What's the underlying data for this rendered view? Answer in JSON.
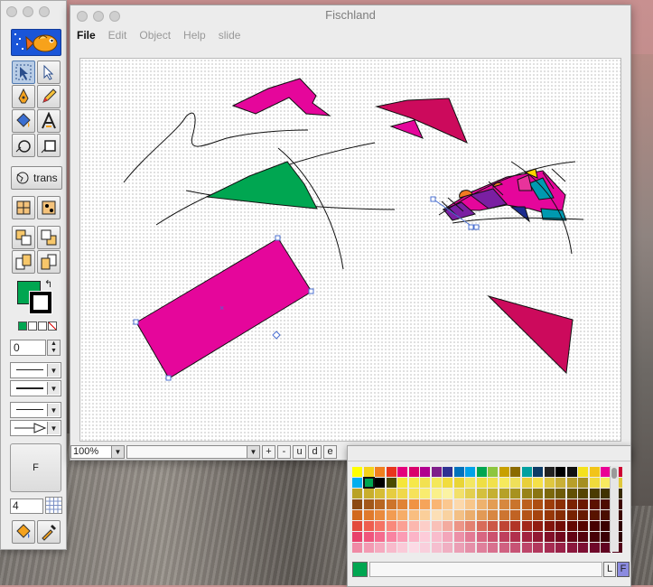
{
  "window": {
    "title": "Fischland",
    "menu": [
      {
        "label": "File",
        "enabled": true
      },
      {
        "label": "Edit",
        "enabled": false
      },
      {
        "label": "Object",
        "enabled": false
      },
      {
        "label": "Help",
        "enabled": false
      },
      {
        "label": "slide",
        "enabled": false
      }
    ]
  },
  "tools": {
    "transform_label": "trans",
    "line_width_value": "0",
    "fill_label": "F",
    "grid_value": "4",
    "fill_color": "#00a651",
    "stroke_color": "#000000"
  },
  "status": {
    "zoom": "100%",
    "buttons": [
      "+",
      "-",
      "u",
      "d",
      "e"
    ]
  },
  "palette": {
    "current_color": "#00a651",
    "buttons": [
      "L",
      "F"
    ],
    "selected_index": 25,
    "colors": [
      "#ffff00",
      "#f5d21a",
      "#f07f1f",
      "#e8351c",
      "#e4007c",
      "#d9006c",
      "#b1008f",
      "#7f1e8a",
      "#2e3192",
      "#0072bc",
      "#00a2e8",
      "#00a651",
      "#8dc63f",
      "#c8a000",
      "#8b6b00",
      "#00a0a0",
      "#0d3b66",
      "#222222",
      "#000000",
      "#111111",
      "#f4e21d",
      "#f2c418",
      "#ea0096",
      "#cc0033",
      "#00aeef",
      "#00a651",
      "#000000",
      "#4a4a00",
      "#f5e63a",
      "#f6e84a",
      "#f2e150",
      "#f4e85a",
      "#f1dc3e",
      "#e9d536",
      "#f3e762",
      "#efdf44",
      "#f1e14c",
      "#f6ea5c",
      "#efe05a",
      "#e8cf3a",
      "#f5e048",
      "#dfc740",
      "#c9b037",
      "#b89f2a",
      "#a58f22",
      "#f0db3c",
      "#f7ea60",
      "#e0c83c",
      "#b9a225",
      "#c8ae2c",
      "#d6bd35",
      "#e6cd40",
      "#f0d84a",
      "#f6e25a",
      "#f9ec6f",
      "#faf08a",
      "#fbf3a3",
      "#f2e06a",
      "#e3cf4e",
      "#d4c03d",
      "#c5b032",
      "#b6a128",
      "#a7921f",
      "#988318",
      "#8a7512",
      "#7c680c",
      "#6f5b08",
      "#625004",
      "#564502",
      "#4b3b01",
      "#403200",
      "#362a00",
      "#8b4a12",
      "#a2581a",
      "#b86622",
      "#cd742b",
      "#e08336",
      "#f09344",
      "#f6a45a",
      "#f9b574",
      "#fbc78f",
      "#fcd8ab",
      "#f8c68a",
      "#eeb26e",
      "#e39d55",
      "#d7883f",
      "#ca742c",
      "#bc601d",
      "#ad4e12",
      "#9d3d0a",
      "#8c2f05",
      "#7b2302",
      "#6b1901",
      "#5b1100",
      "#4c0b00",
      "#3e0700",
      "#d2691e",
      "#e07a2c",
      "#ea8b3e",
      "#f29c52",
      "#f6ad68",
      "#f9be80",
      "#fbcf9a",
      "#fcdfb6",
      "#f9d2a0",
      "#f3c085",
      "#ebad6c",
      "#e29a56",
      "#d88742",
      "#cd7531",
      "#c16323",
      "#b45318",
      "#a6440f",
      "#973708",
      "#872c04",
      "#772202",
      "#671a01",
      "#581300",
      "#4a0d00",
      "#3d0800",
      "#e34b3c",
      "#ee5e4f",
      "#f57364",
      "#f9897b",
      "#fba094",
      "#fcb7ae",
      "#fdcec8",
      "#f9c0b8",
      "#f3ab9f",
      "#ec9587",
      "#e38070",
      "#d86b5a",
      "#cc5746",
      "#bf4535",
      "#b13527",
      "#a2281b",
      "#921d12",
      "#82140b",
      "#720d06",
      "#630803",
      "#550401",
      "#470201",
      "#3a0100",
      "#2e0000",
      "#e8416b",
      "#f0557c",
      "#f56b8e",
      "#f983a1",
      "#fb9bb4",
      "#fcb4c7",
      "#fdccd9",
      "#f9bccc",
      "#f3a6ba",
      "#ec90a7",
      "#e37a94",
      "#d86681",
      "#cc526e",
      "#bf405d",
      "#b1304d",
      "#a2233f",
      "#921832",
      "#820f27",
      "#72081d",
      "#630414",
      "#55020d",
      "#470107",
      "#3a0004",
      "#2e0002",
      "#f08aa5",
      "#f39ab2",
      "#f6aabf",
      "#f8bacb",
      "#facad8",
      "#fcdae5",
      "#f9cfdc",
      "#f5bfcf",
      "#f0afc2",
      "#eb9fb5",
      "#e58fa8",
      "#df7f9b",
      "#d8708e",
      "#d06181",
      "#c75375",
      "#bd4569",
      "#b2385d",
      "#a62c52",
      "#992147",
      "#8b173d",
      "#7d0f33",
      "#6f092a",
      "#610421",
      "#530119"
    ]
  },
  "canvas": {
    "shape_colors": {
      "magenta": "#e5069b",
      "crimson": "#cc0a5c",
      "green": "#00a651",
      "purple": "#7a1fa2",
      "teal": "#0099b0",
      "orange": "#f47b20",
      "yellow": "#ffd400",
      "navy": "#1b2b8f",
      "pink": "#e8339b"
    }
  }
}
